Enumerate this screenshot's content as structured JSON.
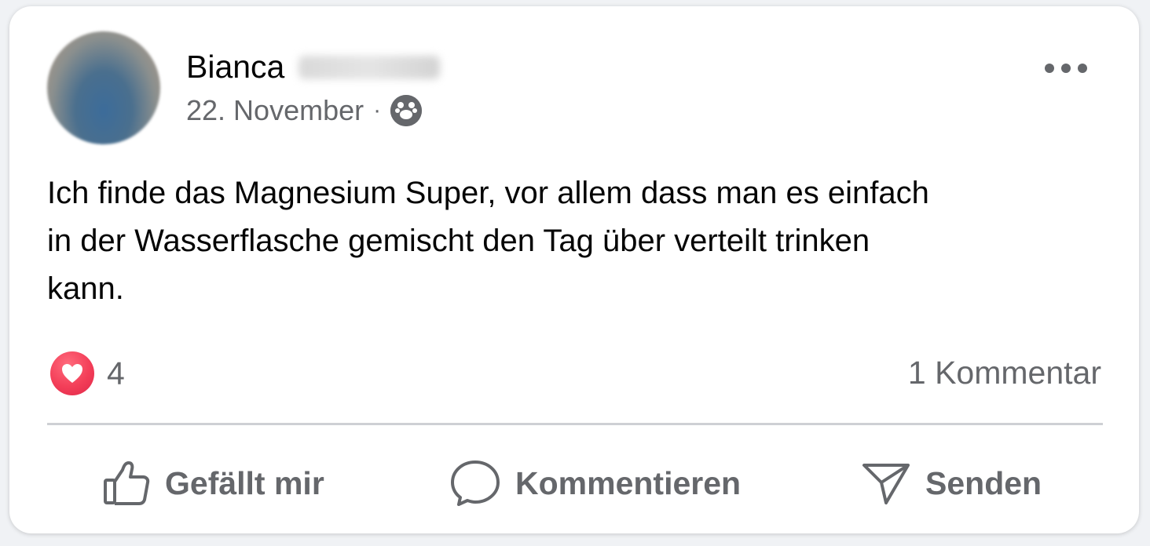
{
  "post": {
    "author": "Bianca",
    "date": "22. November",
    "separator": "·",
    "audience_icon": "friends-icon",
    "text": "Ich finde das Magnesium Super, vor allem dass man es einfach\nin der Wasserflasche gemischt den Tag über verteilt trinken\nkann."
  },
  "reactions": {
    "icon": "heart-icon",
    "count": "4",
    "comments": "1 Kommentar"
  },
  "actions": {
    "like_label": "Gefällt mir",
    "comment_label": "Kommentieren",
    "send_label": "Senden"
  },
  "colors": {
    "text_primary": "#050505",
    "text_secondary": "#65676b",
    "heart": "#f33e58",
    "divider": "#ced0d4"
  }
}
